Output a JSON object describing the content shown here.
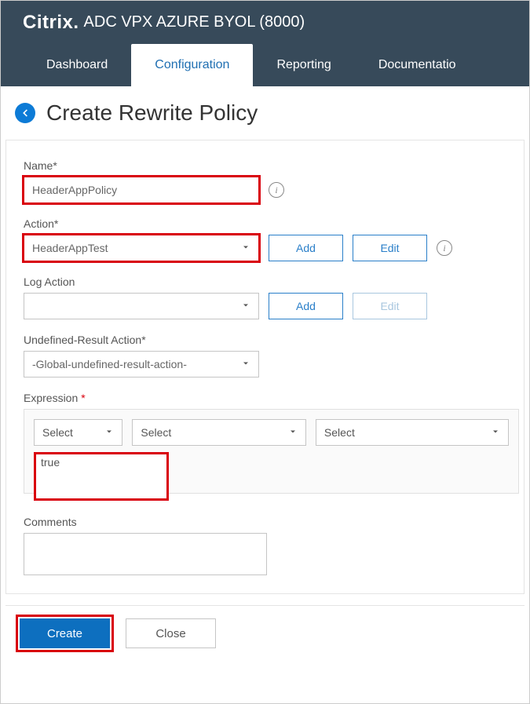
{
  "header": {
    "brand_main": "Citrix",
    "brand_dot": ".",
    "brand_sub": "ADC VPX AZURE BYOL (8000)"
  },
  "tabs": {
    "dashboard": "Dashboard",
    "configuration": "Configuration",
    "reporting": "Reporting",
    "documentation": "Documentatio"
  },
  "page": {
    "title": "Create Rewrite Policy"
  },
  "form": {
    "name_label": "Name*",
    "name_value": "HeaderAppPolicy",
    "action_label": "Action*",
    "action_value": "HeaderAppTest",
    "add_label": "Add",
    "edit_label": "Edit",
    "logaction_label": "Log Action",
    "logaction_value": "",
    "undef_label": "Undefined-Result Action*",
    "undef_value": "-Global-undefined-result-action-",
    "expression_label": "Expression",
    "select_label": "Select",
    "expression_value": "true",
    "comments_label": "Comments",
    "comments_value": ""
  },
  "footer": {
    "create": "Create",
    "close": "Close"
  },
  "info_glyph": "i"
}
